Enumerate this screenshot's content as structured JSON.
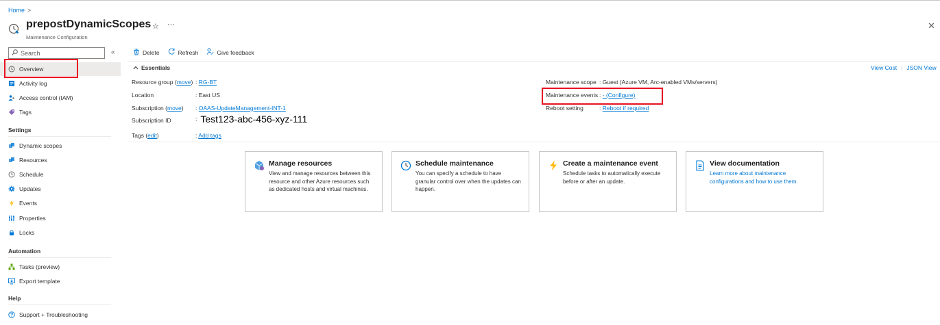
{
  "breadcrumb": {
    "home": "Home",
    "separator": ">"
  },
  "header": {
    "title": "prepostDynamicScopes",
    "subtitle": "Maintenance Configuration",
    "star": "☆",
    "more": "···",
    "close": "✕"
  },
  "search": {
    "placeholder": "Search",
    "collapse": "«"
  },
  "nav": {
    "overview": "Overview",
    "activity_log": "Activity log",
    "access_control": "Access control (IAM)",
    "tags": "Tags",
    "settings_header": "Settings",
    "dynamic_scopes": "Dynamic scopes",
    "resources": "Resources",
    "schedule": "Schedule",
    "updates": "Updates",
    "events": "Events",
    "properties": "Properties",
    "locks": "Locks",
    "automation_header": "Automation",
    "tasks": "Tasks (preview)",
    "export_template": "Export template",
    "help_header": "Help",
    "support": "Support + Troubleshooting"
  },
  "toolbar": {
    "delete": "Delete",
    "refresh": "Refresh",
    "feedback": "Give feedback"
  },
  "essentials": {
    "label": "Essentials",
    "view_cost": "View Cost",
    "divider": "|",
    "json_view": "JSON View",
    "resource_group_label": "Resource group",
    "move": "move",
    "resource_group_value": "RG-BT",
    "location_label": "Location",
    "location_value": "East US",
    "subscription_label": "Subscription",
    "subscription_value": "OAAS-UpdateManagement-INT-1",
    "subscription_id_label": "Subscription ID",
    "subscription_id_value": "Test123-abc-456-xyz-111",
    "tags_label": "Tags",
    "edit": "edit",
    "tags_value": "Add tags",
    "scope_label": "Maintenance scope",
    "scope_value": "Guest (Azure VM, Arc-enabled VMs/servers)",
    "events_label": "Maintenance events",
    "events_value": "- (Configure)",
    "reboot_label": "Reboot setting",
    "reboot_value": "Reboot if required",
    "colon": ":"
  },
  "cards": [
    {
      "title": "Manage resources",
      "desc": "View and manage resources between this resource and other Azure resources such as dedicated hosts and virtual machines."
    },
    {
      "title": "Schedule maintenance",
      "desc": "You can specify a schedule to have granular control over when the updates can happen."
    },
    {
      "title": "Create a maintenance event",
      "desc": "Schedule tasks to automatically execute before or after an update."
    },
    {
      "title": "View documentation",
      "desc": "Learn more about maintenance configurations and how to use them."
    }
  ],
  "colors": {
    "accent": "#0078d4",
    "highlight": "#e81123",
    "selected_bg": "#edebe9"
  }
}
